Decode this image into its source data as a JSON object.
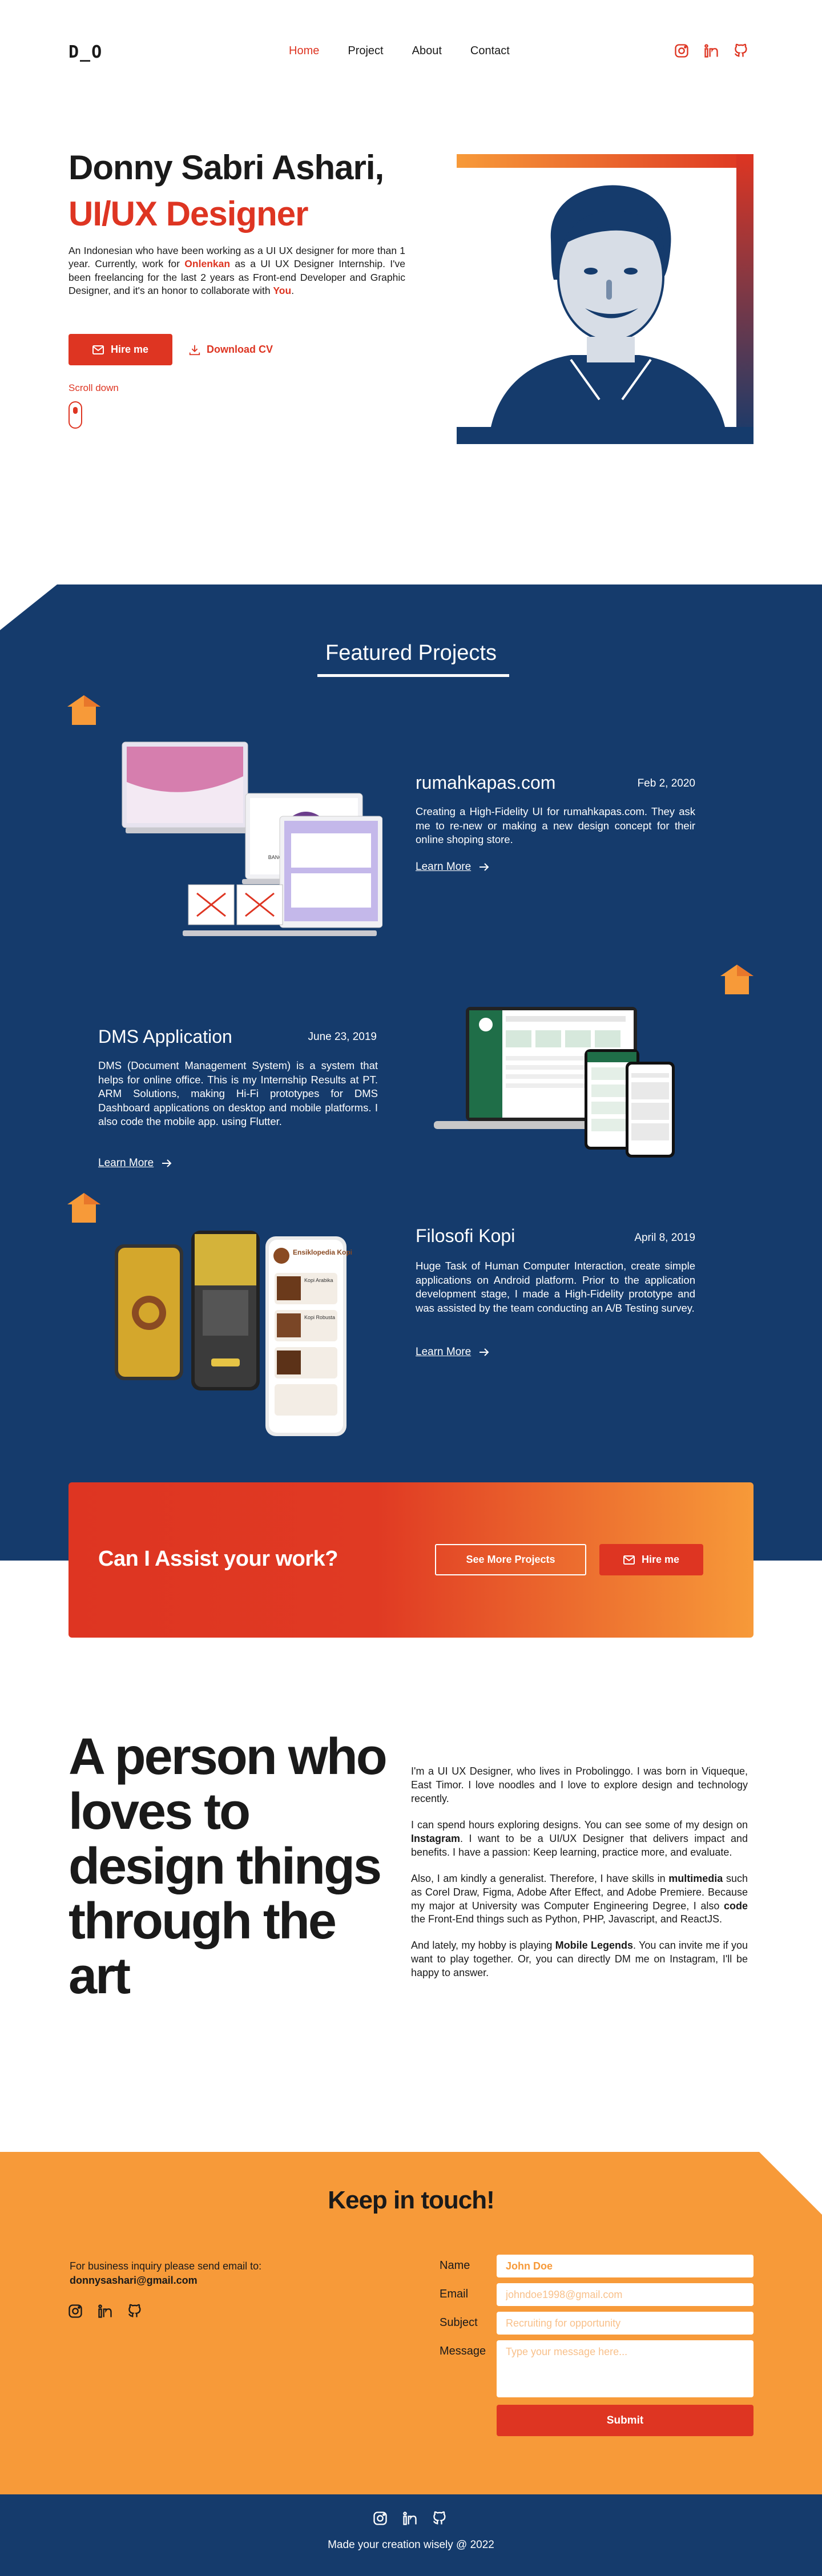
{
  "nav": {
    "logo": "D_O",
    "links": [
      "Home",
      "Project",
      "About",
      "Contact"
    ],
    "active": "Home",
    "social_icons": [
      "instagram-icon",
      "linkedin-icon",
      "github-icon"
    ]
  },
  "hero": {
    "name": "Donny Sabri Ashari,",
    "role": "UI/UX Designer",
    "desc_1": "An Indonesian who have been working as a UI UX designer for more than 1 year. Currently, work for ",
    "desc_company": "Onlenkan",
    "desc_2": " as a UI UX Designer Internship. I've been freelancing for the last 2 years as Front-end Developer and Graphic Designer, and it's an honor to collaborate with ",
    "desc_you": "You",
    "desc_3": ".",
    "hire_label": "Hire me",
    "download_label": "Download CV",
    "scroll_label": "Scroll down"
  },
  "projects": {
    "heading": "Featured Projects",
    "items": [
      {
        "title": "rumahkapas.com",
        "date": "Feb 2, 2020",
        "desc": "Creating a High-Fidelity UI for rumahkapas.com. They ask me to re-new or making a new design concept for their online shoping store.",
        "link": "Learn More"
      },
      {
        "title": "DMS Application",
        "date": "June 23, 2019",
        "desc": "DMS (Document Management System) is a system that helps for online office. This is my Internship Results at PT. ARM Solutions, making Hi-Fi prototypes for DMS Dashboard applications on desktop and mobile platforms. I also code the mobile app. using Flutter.",
        "link": "Learn More"
      },
      {
        "title": "Filosofi Kopi",
        "date": "April 8, 2019",
        "desc": "Huge Task of Human Computer Interaction, create simple applications on Android platform. Prior to the application development stage, I made a High-Fidelity prototype and was assisted by the team conducting an A/B Testing survey.",
        "link": "Learn More"
      }
    ],
    "mockup_text": {
      "rk_hero": "BANGGAIL.com Hadir Kembali",
      "kopi_title": "Ensiklopedia Kopi",
      "kopi_item1": "Kopi Arabika",
      "kopi_item2": "Kopi Robusta"
    }
  },
  "cta": {
    "text": "Can I Assist your work?",
    "see_more": "See More Projects",
    "hire": "Hire me"
  },
  "about": {
    "quote": "A person who loves to design things through the art",
    "p1": "I'm a UI UX Designer, who lives in Probolinggo. I was born in Viqueque, East Timor. I love noodles and I love to explore design and technology recently.",
    "p2a": "I can spend hours exploring designs. You can see some of my design on ",
    "p2b": "Instagram",
    "p2c": ". I want to be a UI/UX Designer that delivers impact and benefits. I have a passion: Keep learning, practice more, and evaluate.",
    "p3a": "Also, I am kindly a generalist. Therefore, I have skills in ",
    "p3b": "multimedia",
    "p3c": " such as Corel Draw, Figma, Adobe After Effect, and Adobe Premiere. Because my major at University was Computer Engineering Degree, I also ",
    "p3d": "code",
    "p3e": " the Front-End things such as Python, PHP, Javascript, and ReactJS.",
    "p4a": "And lately, my hobby is playing ",
    "p4b": "Mobile Legends",
    "p4c": ". You can invite me if you want to play together. Or, you can directly DM me on Instagram, I'll be happy to answer."
  },
  "contact": {
    "title": "Keep in touch!",
    "inquiry": "For business inquiry please send email to:",
    "email": "donnysashari@gmail.com",
    "labels": {
      "name": "Name",
      "email": "Email",
      "subject": "Subject",
      "message": "Message"
    },
    "name_value": "John Doe",
    "email_placeholder": "johndoe1998@gmail.com",
    "subject_placeholder": "Recruiting for opportunity",
    "message_placeholder": "Type your message here...",
    "submit": "Submit"
  },
  "footer": {
    "text": "Made your creation wisely @ 2022"
  },
  "colors": {
    "accent_red": "#de3522",
    "navy": "#153b6c",
    "orange": "#f79a39"
  }
}
